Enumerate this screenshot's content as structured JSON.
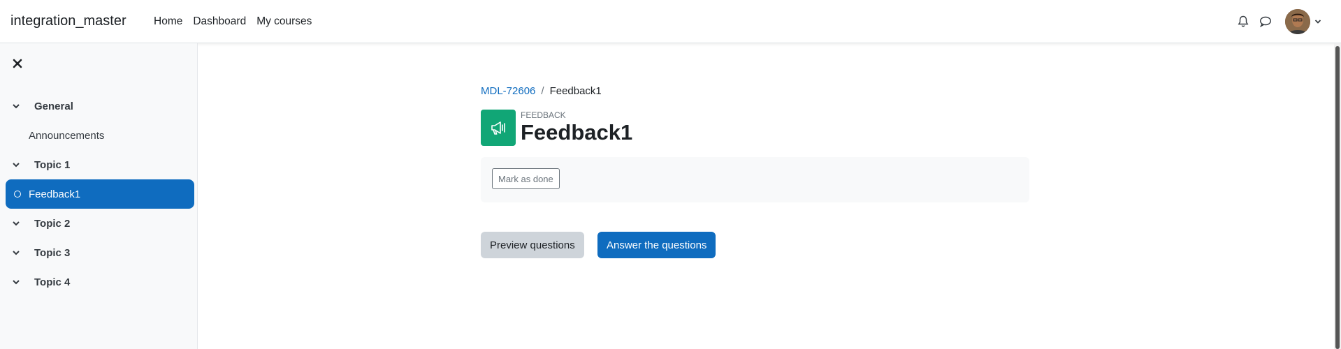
{
  "navbar": {
    "brand": "integration_master",
    "links": [
      "Home",
      "Dashboard",
      "My courses"
    ],
    "notifications_icon": "bell-icon",
    "messages_icon": "chat-bubble-icon",
    "user_menu_icon": "chevron-down-icon"
  },
  "drawer": {
    "close_icon": "close-icon",
    "sections": [
      {
        "label": "General"
      },
      {
        "label": "Announcements"
      },
      {
        "label": "Topic 1"
      },
      {
        "label": "Feedback1"
      },
      {
        "label": "Topic 2"
      },
      {
        "label": "Topic 3"
      },
      {
        "label": "Topic 4"
      }
    ]
  },
  "breadcrumb": {
    "course": "MDL-72606",
    "current": "Feedback1"
  },
  "header": {
    "purpose": "FEEDBACK",
    "title": "Feedback1",
    "icon": "megaphone-icon",
    "icon_color": "#11a676"
  },
  "completion": {
    "mark_done_label": "Mark as done"
  },
  "actions": {
    "preview_label": "Preview questions",
    "answer_label": "Answer the questions"
  },
  "colors": {
    "accent": "#0f6cbf"
  }
}
